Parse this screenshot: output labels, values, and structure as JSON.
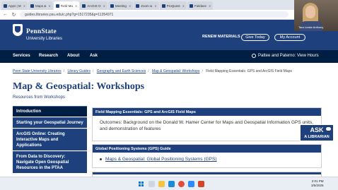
{
  "browser": {
    "tabs": [
      {
        "label": "Apps | M",
        "active": false
      },
      {
        "label": "Maps &",
        "active": false
      },
      {
        "label": "Field Ma",
        "active": true
      },
      {
        "label": "ArcGIS O",
        "active": false
      },
      {
        "label": "Meeting",
        "active": false
      },
      {
        "label": "Zoom w",
        "active": false
      },
      {
        "label": "ProQuest",
        "active": false
      },
      {
        "label": "Fieldwor",
        "active": false
      }
    ],
    "url": "guides.libraries.psu.edu/c.php?g=1517235&p=11354971",
    "back_icon": "arrow-left-icon",
    "refresh_icon": "refresh-icon"
  },
  "webcam": {
    "name": "Tara Leake Anthony"
  },
  "header": {
    "brand_line1": "PennState",
    "brand_line2": "University Libraries",
    "renew_label": "RENEW MATERIALS",
    "give_label": "Give Today",
    "account_label": "My Account",
    "colors": {
      "primary": "#1e407c",
      "dark": "#001e44"
    }
  },
  "nav": {
    "items": [
      "Services",
      "Research",
      "About",
      "Ask"
    ],
    "location": "Pattee and Paterno: View Hours"
  },
  "breadcrumb": {
    "items": [
      "Penn State University Libraries",
      "Library Guides",
      "Geography and Earth Sciences",
      "Map & Geospatial: Workshops",
      "Field Mapping Essentials: GPS and ArcGIS Field Maps"
    ]
  },
  "page": {
    "title": "Map & Geospatial: Workshops",
    "subtitle": "Resources from Workshops"
  },
  "sidebar": {
    "items": [
      "Introduction",
      "Starting your Geospatial Journey",
      "ArcGIS Online: Creating Interactive Maps and Applications",
      "From Data to Discovery: Navigate Open Geospatial Resources in the PTAA"
    ]
  },
  "boxes": {
    "field": {
      "heading": "Field Mapping Essentials: GPS and ArcGIS Field Maps",
      "body": "Outcomes: Background on the Donald W. Hamer Center for Maps and Geospatial Information GPS units, and demonstration of features"
    },
    "gps": {
      "heading": "Global Positioning Systems (GPS) Guide",
      "link": "Maps & Geospatial: Global Positioning Systems (GPS)"
    }
  },
  "ask": {
    "line1": "ASK",
    "line2": "A LIBRARIAN"
  },
  "taskbar": {
    "time": "2:01 PM",
    "date": "3/5/2026",
    "icons": [
      "windows-icon",
      "search-icon",
      "explorer-icon",
      "edge-icon",
      "chrome-icon",
      "zoom-icon",
      "powerpoint-icon"
    ]
  }
}
